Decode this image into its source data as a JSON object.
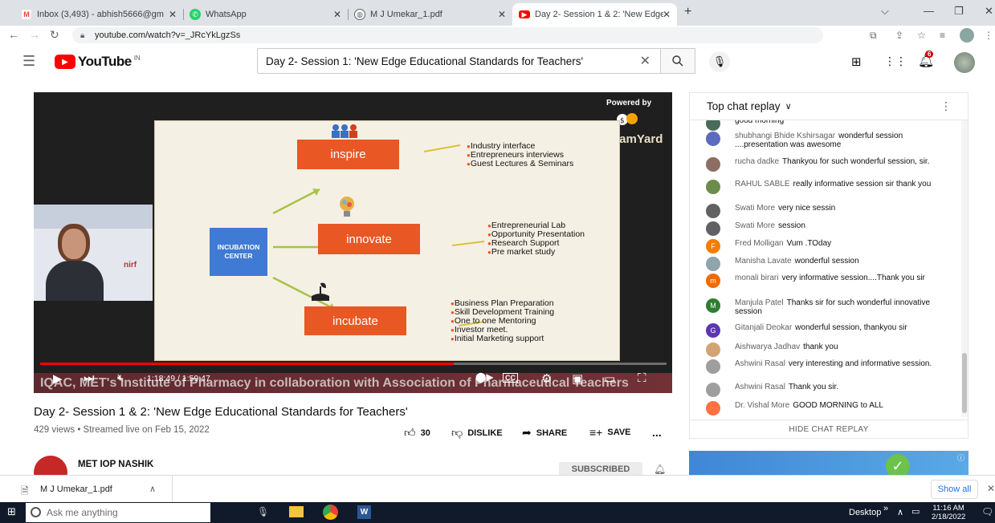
{
  "tabs": [
    {
      "title": "Inbox (3,493) - abhish5666@gm",
      "icon": "gmail-icon"
    },
    {
      "title": "WhatsApp",
      "icon": "whatsapp-icon"
    },
    {
      "title": "M J Umekar_1.pdf",
      "icon": "globe-icon"
    },
    {
      "title": "Day 2- Session 1 & 2: 'New Edge",
      "icon": "youtube-icon",
      "active": true
    }
  ],
  "address": {
    "url": "youtube.com/watch?v=_JRcYkLgzSs"
  },
  "youtube": {
    "logo_text": "YouTube",
    "logo_region": "IN",
    "search_value": "Day 2- Session 1: 'New Edge Educational Standards for Teachers'",
    "notifications_count": "6"
  },
  "video": {
    "powered_by": "Powered by",
    "streamyard": "StreamYard",
    "slide": {
      "center_label": "INCUBATION CENTER",
      "inspire": "inspire",
      "innovate": "innovate",
      "incubate": "incubate",
      "inspire_bullets": [
        "Industry interface",
        "Entrepreneurs interviews",
        "Guest Lectures & Seminars"
      ],
      "innovate_bullets": [
        "Entrepreneurial Lab",
        "Opportunity Presentation",
        "Research Support",
        "Pre market study"
      ],
      "incubate_bullets": [
        "Business Plan Preparation",
        "Skill Development Training",
        "One to one Mentoring",
        "Investor meet.",
        "Initial Marketing support"
      ]
    },
    "ticker": "IQAC, MET's Institute of Pharmacy in collaboration with Association of Pharmaceutical Teachers",
    "time": "1:18:49 / 1:59:47",
    "progress": 0.66
  },
  "title": "Day 2- Session 1 & 2: 'New Edge Educational Standards for Teachers'",
  "meta": "429 views • Streamed live on Feb 15, 2022",
  "actions": {
    "likes": "30",
    "dislike": "DISLIKE",
    "share": "SHARE",
    "save": "SAVE",
    "more": "..."
  },
  "channel": {
    "name": "MET IOP NASHIK",
    "subscribe": "SUBSCRIBED"
  },
  "chat": {
    "header": "Top chat replay",
    "partial_top": "good morning",
    "messages": [
      {
        "author": "shubhangi Bhide Kshirsagar",
        "text": "wonderful session ....presentation was awesome",
        "avatar": "",
        "color": "#5c6bc0"
      },
      {
        "author": "rucha dadke",
        "text": "Thankyou for such wonderful session, sir.",
        "avatar": "",
        "color": "#8d6e63"
      },
      {
        "author": "RAHUL SABLE",
        "text": "really informative session sir thank you",
        "avatar": "",
        "color": "#6d8b4a"
      },
      {
        "author": "Swati More",
        "text": "very nice sessin",
        "avatar": "",
        "color": "#616161"
      },
      {
        "author": "Swati More",
        "text": "session",
        "avatar": "",
        "color": "#616161"
      },
      {
        "author": "Fred Molligan",
        "text": "Vum .TOday",
        "avatar": "F",
        "color": "#f57c00"
      },
      {
        "author": "Manisha Lavate",
        "text": "wonderful session",
        "avatar": "",
        "color": "#90a4ae"
      },
      {
        "author": "monali birari",
        "text": "very informative session....Thank you sir",
        "avatar": "m",
        "color": "#ef6c00"
      },
      {
        "author": "Manjula Patel",
        "text": "Thanks sir for such wonderful innovative session",
        "avatar": "M",
        "color": "#2e7d32"
      },
      {
        "author": "Gitanjali Deokar",
        "text": "wonderful session, thankyou sir",
        "avatar": "G",
        "color": "#5e35b1"
      },
      {
        "author": "Aishwarya Jadhav",
        "text": "thank you",
        "avatar": "",
        "color": "#d4a373"
      },
      {
        "author": "Ashwini Rasal",
        "text": "very interesting and informative session.",
        "avatar": "",
        "color": "#9e9e9e"
      },
      {
        "author": "Ashwini Rasal",
        "text": "Thank you sir.",
        "avatar": "",
        "color": "#9e9e9e"
      },
      {
        "author": "Dr. Vishal More",
        "text": "GOOD MORNING to ALL",
        "avatar": "",
        "color": "#ff7043"
      }
    ],
    "hide": "HIDE CHAT REPLAY"
  },
  "download": {
    "file": "M J Umekar_1.pdf",
    "show_all": "Show all"
  },
  "taskbar": {
    "search": "Ask me anything",
    "desktop": "Desktop",
    "time": "11:16 AM",
    "date": "2/18/2022"
  }
}
